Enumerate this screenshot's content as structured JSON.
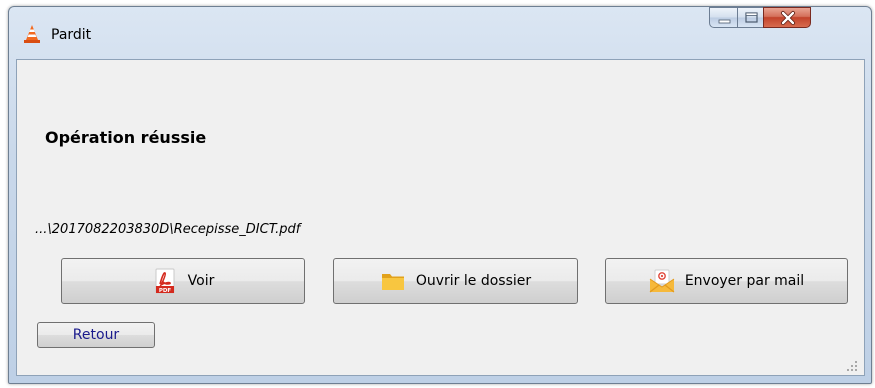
{
  "window": {
    "title": "Pardit",
    "icon": "traffic-cone-icon",
    "controls": [
      "minimize-icon",
      "maximize-icon",
      "close-icon"
    ]
  },
  "main": {
    "heading": "Opération réussie",
    "file_path": "...\\2017082203830D\\Recepisse_DICT.pdf"
  },
  "actions": {
    "voir": {
      "label": "Voir",
      "icon": "pdf-icon"
    },
    "ouvrir_dossier": {
      "label": "Ouvrir le dossier",
      "icon": "folder-icon"
    },
    "envoyer_mail": {
      "label": "Envoyer par mail",
      "icon": "mail-envelope-icon"
    }
  },
  "footer": {
    "retour_label": "Retour"
  },
  "colors": {
    "client_bg": "#f0f0f0",
    "title_gradient_top": "#dbe6f3",
    "close_button": "#c2422a",
    "retour_text": "#1a1a8c"
  }
}
